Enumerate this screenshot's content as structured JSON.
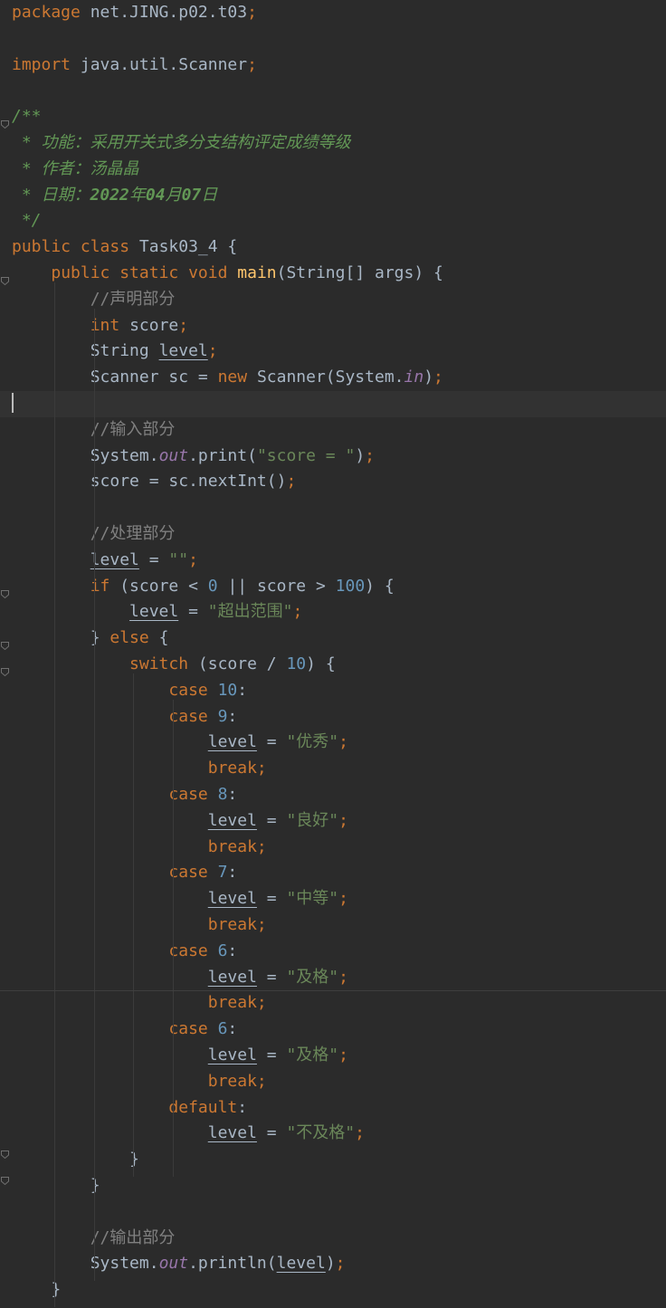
{
  "editor": {
    "colors": {
      "background": "#2b2b2b",
      "keyword": "#cc7832",
      "identifier": "#a9b7c6",
      "number": "#6897bb",
      "string": "#6a8759",
      "comment": "#808080",
      "doc_comment": "#629755",
      "method": "#ffc66d",
      "static_field": "#9876aa"
    },
    "lines": [
      [
        [
          "kw",
          "package"
        ],
        [
          "pl",
          " net.JING.p02.t03"
        ],
        [
          "kw",
          ";"
        ]
      ],
      [],
      [
        [
          "kw",
          "import"
        ],
        [
          "pl",
          " java.util.Scanner"
        ],
        [
          "kw",
          ";"
        ]
      ],
      [],
      [
        [
          "doc",
          "/**"
        ]
      ],
      [
        [
          "doc",
          " * 功能：采用开关式多分支结构评定成绩等级"
        ]
      ],
      [
        [
          "doc",
          " * 作者：汤晶晶"
        ]
      ],
      [
        [
          "doc",
          " * 日期："
        ],
        [
          "doctag",
          "2022"
        ],
        [
          "doc",
          "年"
        ],
        [
          "doctag",
          "04"
        ],
        [
          "doc",
          "月"
        ],
        [
          "doctag",
          "07"
        ],
        [
          "doc",
          "日"
        ]
      ],
      [
        [
          "doc",
          " */"
        ]
      ],
      [
        [
          "kw",
          "public class "
        ],
        [
          "pl",
          "Task03_4 {"
        ]
      ],
      [
        [
          "pl",
          "    "
        ],
        [
          "kw",
          "public static void "
        ],
        [
          "fn",
          "main"
        ],
        [
          "pl",
          "(String[] args) {"
        ]
      ],
      [
        [
          "pl",
          "        "
        ],
        [
          "cmt",
          "//声明部分"
        ]
      ],
      [
        [
          "pl",
          "        "
        ],
        [
          "kw",
          "int "
        ],
        [
          "pl",
          "score"
        ],
        [
          "kw",
          ";"
        ]
      ],
      [
        [
          "pl",
          "        String "
        ],
        [
          "var",
          "level"
        ],
        [
          "kw",
          ";"
        ]
      ],
      [
        [
          "pl",
          "        Scanner sc = "
        ],
        [
          "kw",
          "new "
        ],
        [
          "pl",
          "Scanner(System."
        ],
        [
          "st",
          "in"
        ],
        [
          "pl",
          ")"
        ],
        [
          "kw",
          ";"
        ]
      ],
      [],
      [
        [
          "pl",
          "        "
        ],
        [
          "cmt",
          "//输入部分"
        ]
      ],
      [
        [
          "pl",
          "        System."
        ],
        [
          "st",
          "out"
        ],
        [
          "pl",
          ".print("
        ],
        [
          "str",
          "\"score = \""
        ],
        [
          "pl",
          ")"
        ],
        [
          "kw",
          ";"
        ]
      ],
      [
        [
          "pl",
          "        score = sc.nextInt()"
        ],
        [
          "kw",
          ";"
        ]
      ],
      [],
      [
        [
          "pl",
          "        "
        ],
        [
          "cmt",
          "//处理部分"
        ]
      ],
      [
        [
          "pl",
          "        "
        ],
        [
          "var",
          "level"
        ],
        [
          "pl",
          " = "
        ],
        [
          "str",
          "\"\""
        ],
        [
          "kw",
          ";"
        ]
      ],
      [
        [
          "pl",
          "        "
        ],
        [
          "kw",
          "if "
        ],
        [
          "pl",
          "(score < "
        ],
        [
          "num",
          "0"
        ],
        [
          "pl",
          " || score > "
        ],
        [
          "num",
          "100"
        ],
        [
          "pl",
          ") {"
        ]
      ],
      [
        [
          "pl",
          "            "
        ],
        [
          "var",
          "level"
        ],
        [
          "pl",
          " = "
        ],
        [
          "str",
          "\"超出范围\""
        ],
        [
          "kw",
          ";"
        ]
      ],
      [
        [
          "pl",
          "        } "
        ],
        [
          "kw",
          "else "
        ],
        [
          "pl",
          "{"
        ]
      ],
      [
        [
          "pl",
          "            "
        ],
        [
          "kw",
          "switch "
        ],
        [
          "pl",
          "(score / "
        ],
        [
          "num",
          "10"
        ],
        [
          "pl",
          ") {"
        ]
      ],
      [
        [
          "pl",
          "                "
        ],
        [
          "kw",
          "case "
        ],
        [
          "num",
          "10"
        ],
        [
          "pl",
          ":"
        ]
      ],
      [
        [
          "pl",
          "                "
        ],
        [
          "kw",
          "case "
        ],
        [
          "num",
          "9"
        ],
        [
          "pl",
          ":"
        ]
      ],
      [
        [
          "pl",
          "                    "
        ],
        [
          "var",
          "level"
        ],
        [
          "pl",
          " = "
        ],
        [
          "str",
          "\"优秀\""
        ],
        [
          "kw",
          ";"
        ]
      ],
      [
        [
          "pl",
          "                    "
        ],
        [
          "kw",
          "break;"
        ]
      ],
      [
        [
          "pl",
          "                "
        ],
        [
          "kw",
          "case "
        ],
        [
          "num",
          "8"
        ],
        [
          "pl",
          ":"
        ]
      ],
      [
        [
          "pl",
          "                    "
        ],
        [
          "var",
          "level"
        ],
        [
          "pl",
          " = "
        ],
        [
          "str",
          "\"良好\""
        ],
        [
          "kw",
          ";"
        ]
      ],
      [
        [
          "pl",
          "                    "
        ],
        [
          "kw",
          "break;"
        ]
      ],
      [
        [
          "pl",
          "                "
        ],
        [
          "kw",
          "case "
        ],
        [
          "num",
          "7"
        ],
        [
          "pl",
          ":"
        ]
      ],
      [
        [
          "pl",
          "                    "
        ],
        [
          "var",
          "level"
        ],
        [
          "pl",
          " = "
        ],
        [
          "str",
          "\"中等\""
        ],
        [
          "kw",
          ";"
        ]
      ],
      [
        [
          "pl",
          "                    "
        ],
        [
          "kw",
          "break;"
        ]
      ],
      [
        [
          "pl",
          "                "
        ],
        [
          "kw",
          "case "
        ],
        [
          "num",
          "6"
        ],
        [
          "pl",
          ":"
        ]
      ],
      [
        [
          "pl",
          "                    "
        ],
        [
          "var",
          "level"
        ],
        [
          "pl",
          " = "
        ],
        [
          "str",
          "\"及格\""
        ],
        [
          "kw",
          ";"
        ]
      ],
      [
        [
          "pl",
          "                    "
        ],
        [
          "kw",
          "break;"
        ]
      ],
      [
        [
          "pl",
          "                "
        ],
        [
          "kw",
          "case "
        ],
        [
          "num",
          "6"
        ],
        [
          "pl",
          ":"
        ]
      ],
      [
        [
          "pl",
          "                    "
        ],
        [
          "var",
          "level"
        ],
        [
          "pl",
          " = "
        ],
        [
          "str",
          "\"及格\""
        ],
        [
          "kw",
          ";"
        ]
      ],
      [
        [
          "pl",
          "                    "
        ],
        [
          "kw",
          "break;"
        ]
      ],
      [
        [
          "pl",
          "                "
        ],
        [
          "kw",
          "default"
        ],
        [
          "pl",
          ":"
        ]
      ],
      [
        [
          "pl",
          "                    "
        ],
        [
          "var",
          "level"
        ],
        [
          "pl",
          " = "
        ],
        [
          "str",
          "\"不及格\""
        ],
        [
          "kw",
          ";"
        ]
      ],
      [
        [
          "pl",
          "            }"
        ]
      ],
      [
        [
          "pl",
          "        }"
        ]
      ],
      [],
      [
        [
          "pl",
          "        "
        ],
        [
          "cmt",
          "//输出部分"
        ]
      ],
      [
        [
          "pl",
          "        System."
        ],
        [
          "st",
          "out"
        ],
        [
          "pl",
          ".println("
        ],
        [
          "var",
          "level"
        ],
        [
          "pl",
          ")"
        ],
        [
          "kw",
          ";"
        ]
      ],
      [
        [
          "pl",
          "    }"
        ]
      ]
    ]
  }
}
